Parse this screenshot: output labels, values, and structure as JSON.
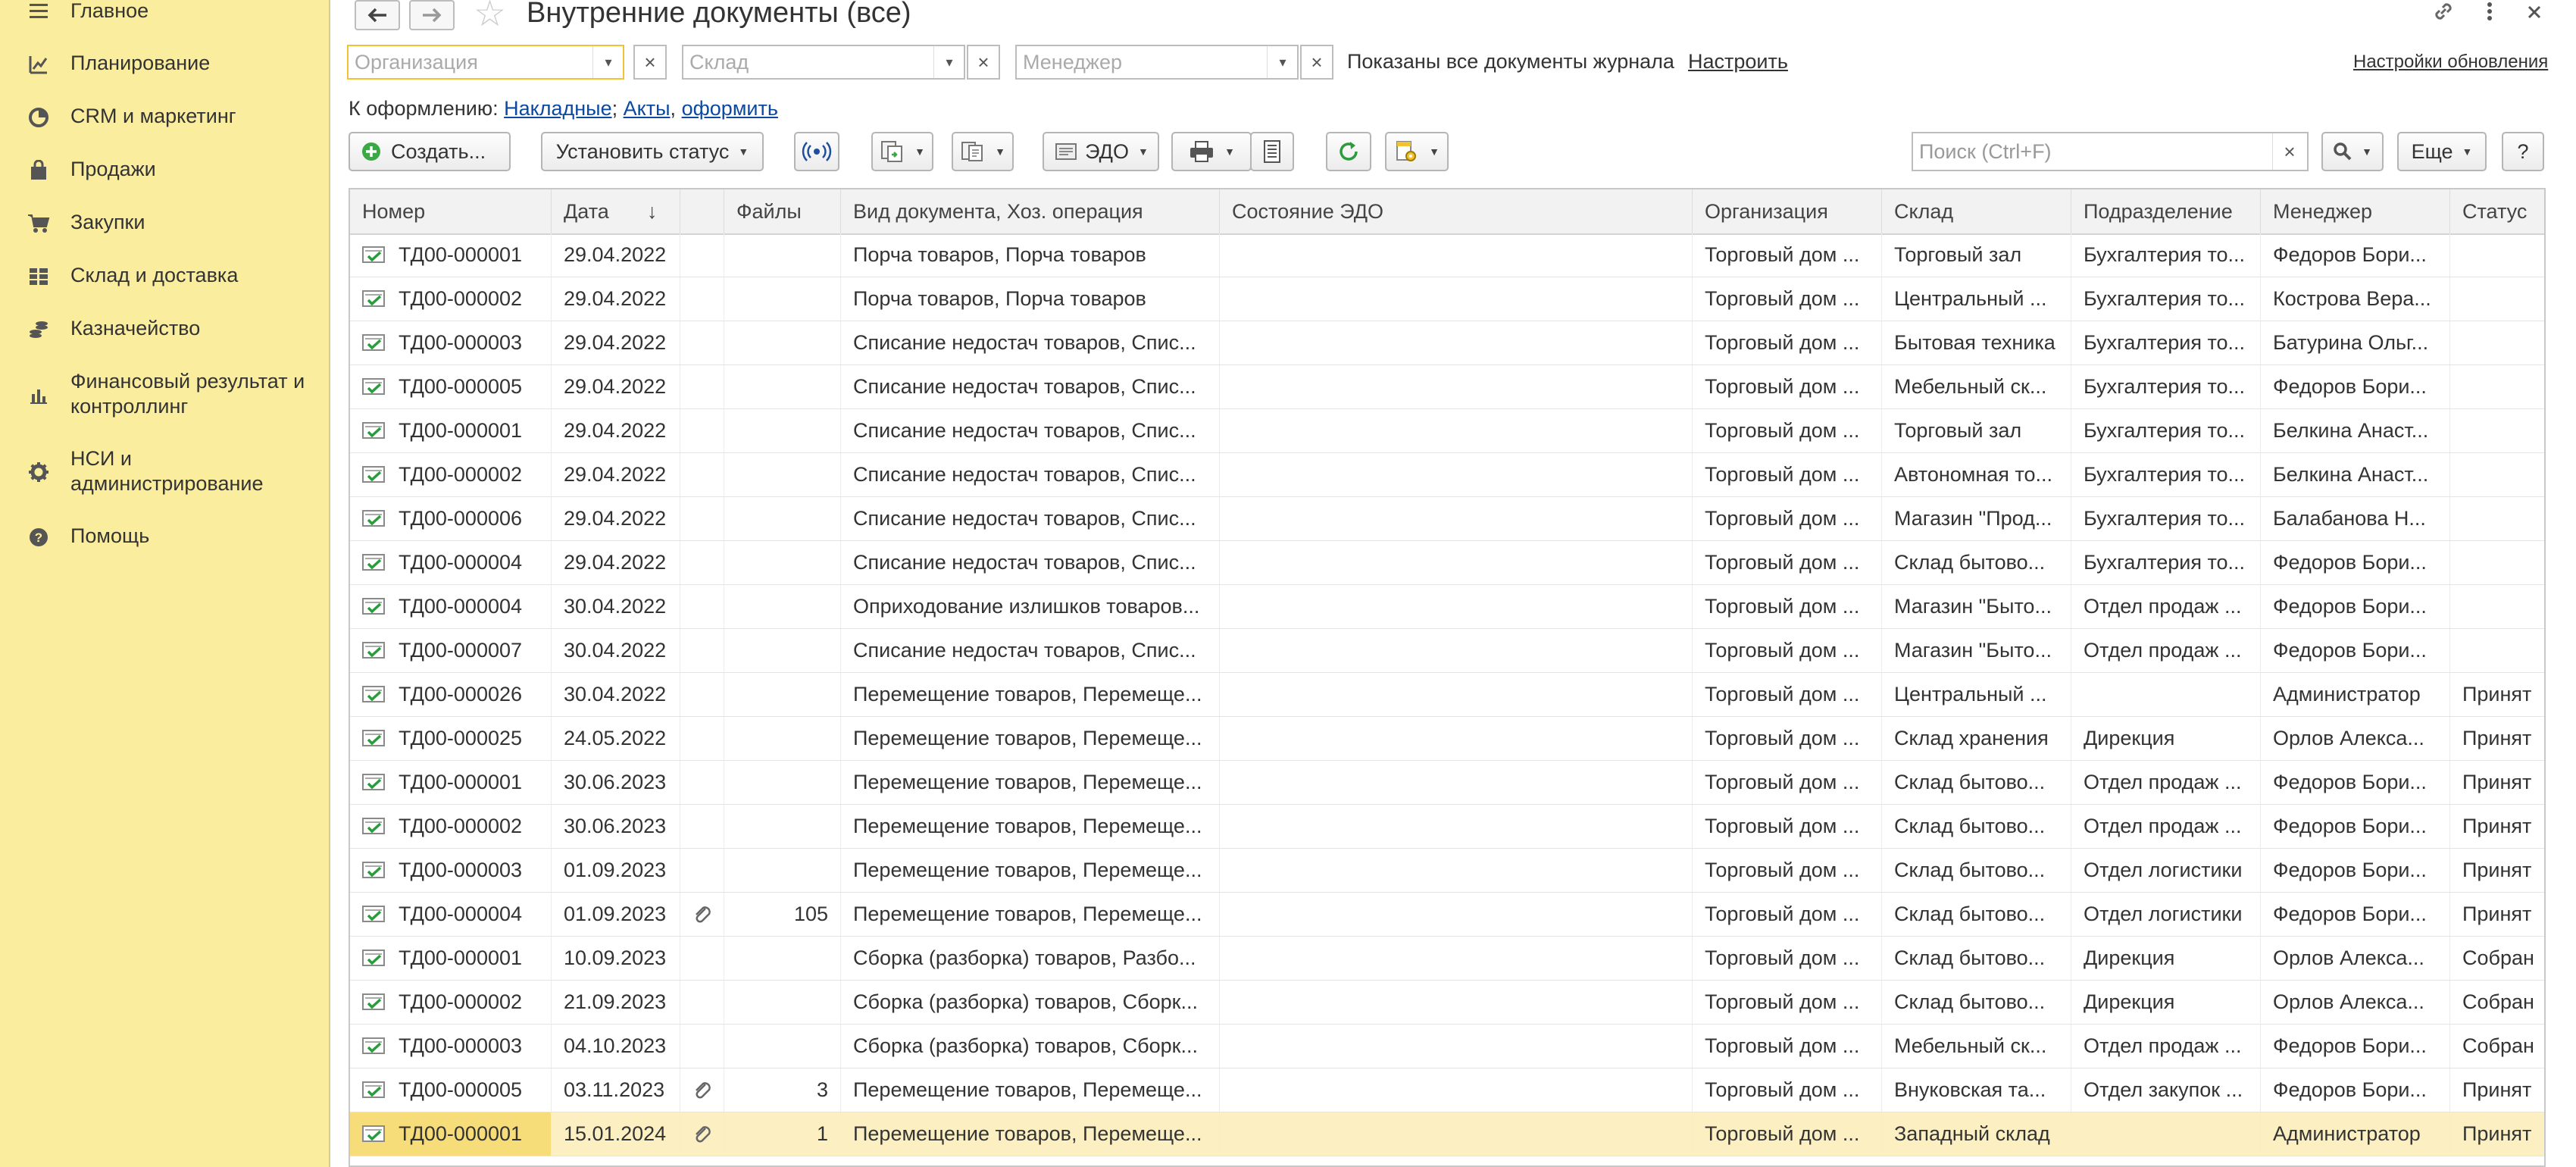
{
  "sidebar": {
    "items": [
      {
        "label": "Главное",
        "icon": "menu-lines-icon"
      },
      {
        "label": "Планирование",
        "icon": "planning-chart-icon"
      },
      {
        "label": "CRM и маркетинг",
        "icon": "crm-pie-icon"
      },
      {
        "label": "Продажи",
        "icon": "shopping-bag-icon"
      },
      {
        "label": "Закупки",
        "icon": "cart-icon"
      },
      {
        "label": "Склад и доставка",
        "icon": "warehouse-grid-icon"
      },
      {
        "label": "Казначейство",
        "icon": "coins-icon"
      },
      {
        "label": "Финансовый результат и контроллинг",
        "icon": "bar-chart-icon"
      },
      {
        "label": "НСИ и администрирование",
        "icon": "gear-icon"
      },
      {
        "label": "Помощь",
        "icon": "help-icon"
      }
    ]
  },
  "header": {
    "title": "Внутренние документы (все)"
  },
  "filters": {
    "organization_placeholder": "Организация",
    "warehouse_placeholder": "Склад",
    "manager_placeholder": "Менеджер",
    "status_text": "Показаны все документы журнала",
    "configure_link": "Настроить",
    "update_settings_link": "Настройки обновления"
  },
  "to_process": {
    "label": "К оформлению:",
    "link1": "Накладные",
    "sep1": ";",
    "link2": "Акты",
    "sep2": ",",
    "link3": "оформить"
  },
  "toolbar": {
    "create_label": "Создать...",
    "set_status_label": "Установить статус",
    "edo_label": "ЭДО",
    "search_placeholder": "Поиск (Ctrl+F)",
    "more_label": "Еще",
    "help_label": "?"
  },
  "table": {
    "columns": [
      "Номер",
      "Дата",
      "",
      "Файлы",
      "Вид документа, Хоз. операция",
      "Состояние ЭДО",
      "Организация",
      "Склад",
      "Подразделение",
      "Менеджер",
      "Статус"
    ],
    "sort_indicator": "↓",
    "rows": [
      {
        "num": "ТД00-000001",
        "date": "29.04.2022",
        "clip": false,
        "files": "",
        "type": "Порча товаров, Порча товаров",
        "edo": "",
        "org": "Торговый дом ...",
        "wh": "Торговый зал",
        "dept": "Бухгалтерия то...",
        "mgr": "Федоров Бори...",
        "status": ""
      },
      {
        "num": "ТД00-000002",
        "date": "29.04.2022",
        "clip": false,
        "files": "",
        "type": "Порча товаров, Порча товаров",
        "edo": "",
        "org": "Торговый дом ...",
        "wh": "Центральный ...",
        "dept": "Бухгалтерия то...",
        "mgr": "Кострова Вера...",
        "status": ""
      },
      {
        "num": "ТД00-000003",
        "date": "29.04.2022",
        "clip": false,
        "files": "",
        "type": "Списание недостач товаров, Спис...",
        "edo": "",
        "org": "Торговый дом ...",
        "wh": "Бытовая техника",
        "dept": "Бухгалтерия то...",
        "mgr": "Батурина Ольг...",
        "status": ""
      },
      {
        "num": "ТД00-000005",
        "date": "29.04.2022",
        "clip": false,
        "files": "",
        "type": "Списание недостач товаров, Спис...",
        "edo": "",
        "org": "Торговый дом ...",
        "wh": "Мебельный ск...",
        "dept": "Бухгалтерия то...",
        "mgr": "Федоров Бори...",
        "status": ""
      },
      {
        "num": "ТД00-000001",
        "date": "29.04.2022",
        "clip": false,
        "files": "",
        "type": "Списание недостач товаров, Спис...",
        "edo": "",
        "org": "Торговый дом ...",
        "wh": "Торговый зал",
        "dept": "Бухгалтерия то...",
        "mgr": "Белкина Анаст...",
        "status": ""
      },
      {
        "num": "ТД00-000002",
        "date": "29.04.2022",
        "clip": false,
        "files": "",
        "type": "Списание недостач товаров, Спис...",
        "edo": "",
        "org": "Торговый дом ...",
        "wh": "Автономная то...",
        "dept": "Бухгалтерия то...",
        "mgr": "Белкина Анаст...",
        "status": ""
      },
      {
        "num": "ТД00-000006",
        "date": "29.04.2022",
        "clip": false,
        "files": "",
        "type": "Списание недостач товаров, Спис...",
        "edo": "",
        "org": "Торговый дом ...",
        "wh": "Магазин \"Прод...",
        "dept": "Бухгалтерия то...",
        "mgr": "Балабанова Н...",
        "status": ""
      },
      {
        "num": "ТД00-000004",
        "date": "29.04.2022",
        "clip": false,
        "files": "",
        "type": "Списание недостач товаров, Спис...",
        "edo": "",
        "org": "Торговый дом ...",
        "wh": "Склад бытово...",
        "dept": "Бухгалтерия то...",
        "mgr": "Федоров Бори...",
        "status": ""
      },
      {
        "num": "ТД00-000004",
        "date": "30.04.2022",
        "clip": false,
        "files": "",
        "type": "Оприходование излишков товаров...",
        "edo": "",
        "org": "Торговый дом ...",
        "wh": "Магазин \"Быто...",
        "dept": "Отдел продаж ...",
        "mgr": "Федоров Бори...",
        "status": ""
      },
      {
        "num": "ТД00-000007",
        "date": "30.04.2022",
        "clip": false,
        "files": "",
        "type": "Списание недостач товаров, Спис...",
        "edo": "",
        "org": "Торговый дом ...",
        "wh": "Магазин \"Быто...",
        "dept": "Отдел продаж ...",
        "mgr": "Федоров Бори...",
        "status": ""
      },
      {
        "num": "ТД00-000026",
        "date": "30.04.2022",
        "clip": false,
        "files": "",
        "type": "Перемещение товаров, Перемеще...",
        "edo": "",
        "org": "Торговый дом ...",
        "wh": "Центральный ...",
        "dept": "",
        "mgr": "Администратор",
        "status": "Принят"
      },
      {
        "num": "ТД00-000025",
        "date": "24.05.2022",
        "clip": false,
        "files": "",
        "type": "Перемещение товаров, Перемеще...",
        "edo": "",
        "org": "Торговый дом ...",
        "wh": "Склад хранения",
        "dept": "Дирекция",
        "mgr": "Орлов Алекса...",
        "status": "Принят"
      },
      {
        "num": "ТД00-000001",
        "date": "30.06.2023",
        "clip": false,
        "files": "",
        "type": "Перемещение товаров, Перемеще...",
        "edo": "",
        "org": "Торговый дом ...",
        "wh": "Склад бытово...",
        "dept": "Отдел продаж ...",
        "mgr": "Федоров Бори...",
        "status": "Принят"
      },
      {
        "num": "ТД00-000002",
        "date": "30.06.2023",
        "clip": false,
        "files": "",
        "type": "Перемещение товаров, Перемеще...",
        "edo": "",
        "org": "Торговый дом ...",
        "wh": "Склад бытово...",
        "dept": "Отдел продаж ...",
        "mgr": "Федоров Бори...",
        "status": "Принят"
      },
      {
        "num": "ТД00-000003",
        "date": "01.09.2023",
        "clip": false,
        "files": "",
        "type": "Перемещение товаров, Перемеще...",
        "edo": "",
        "org": "Торговый дом ...",
        "wh": "Склад бытово...",
        "dept": "Отдел логистики",
        "mgr": "Федоров Бори...",
        "status": "Принят"
      },
      {
        "num": "ТД00-000004",
        "date": "01.09.2023",
        "clip": true,
        "files": "105",
        "type": "Перемещение товаров, Перемеще...",
        "edo": "",
        "org": "Торговый дом ...",
        "wh": "Склад бытово...",
        "dept": "Отдел логистики",
        "mgr": "Федоров Бори...",
        "status": "Принят"
      },
      {
        "num": "ТД00-000001",
        "date": "10.09.2023",
        "clip": false,
        "files": "",
        "type": "Сборка (разборка) товаров, Разбо...",
        "edo": "",
        "org": "Торговый дом ...",
        "wh": "Склад бытово...",
        "dept": "Дирекция",
        "mgr": "Орлов Алекса...",
        "status": "Собран"
      },
      {
        "num": "ТД00-000002",
        "date": "21.09.2023",
        "clip": false,
        "files": "",
        "type": "Сборка (разборка) товаров, Сборк...",
        "edo": "",
        "org": "Торговый дом ...",
        "wh": "Склад бытово...",
        "dept": "Дирекция",
        "mgr": "Орлов Алекса...",
        "status": "Собран"
      },
      {
        "num": "ТД00-000003",
        "date": "04.10.2023",
        "clip": false,
        "files": "",
        "type": "Сборка (разборка) товаров, Сборк...",
        "edo": "",
        "org": "Торговый дом ...",
        "wh": "Мебельный ск...",
        "dept": "Отдел продаж ...",
        "mgr": "Федоров Бори...",
        "status": "Собран"
      },
      {
        "num": "ТД00-000005",
        "date": "03.11.2023",
        "clip": true,
        "files": "3",
        "type": "Перемещение товаров, Перемеще...",
        "edo": "",
        "org": "Торговый дом ...",
        "wh": "Внуковская та...",
        "dept": "Отдел закупок ...",
        "mgr": "Федоров Бори...",
        "status": "Принят"
      },
      {
        "num": "ТД00-000001",
        "date": "15.01.2024",
        "clip": true,
        "files": "1",
        "type": "Перемещение товаров, Перемеще...",
        "edo": "",
        "org": "Торговый дом ...",
        "wh": "Западный склад",
        "dept": "",
        "mgr": "Администратор",
        "status": "Принят",
        "selected": true
      }
    ]
  }
}
